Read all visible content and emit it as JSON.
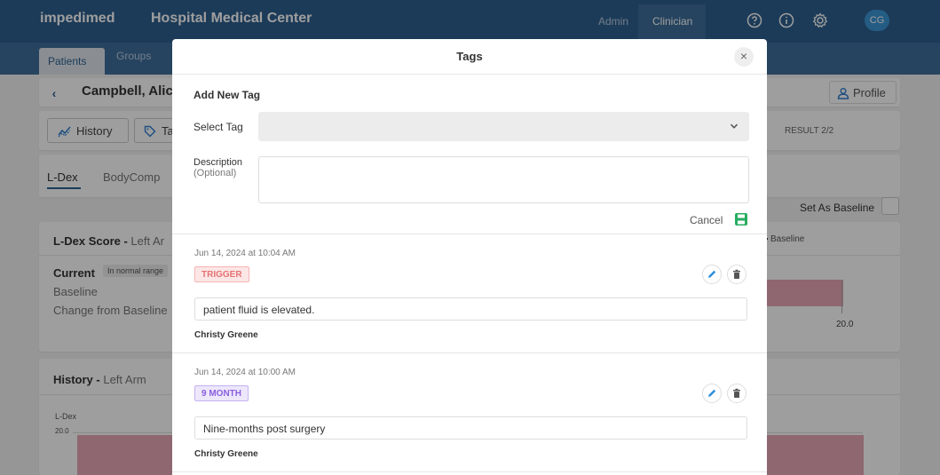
{
  "header": {
    "brand": "impedimed",
    "center_name": "Hospital Medical Center",
    "nav": {
      "admin": "Admin",
      "clinician": "Clinician"
    },
    "icons": [
      "help-circle-icon",
      "info-icon",
      "gear-icon"
    ],
    "avatar": "CG"
  },
  "subnav": {
    "patients": "Patients",
    "groups": "Groups"
  },
  "patient": {
    "back": "‹",
    "name": "Campbell, Alic",
    "profile": "Profile"
  },
  "actions": {
    "history": "History",
    "tags": "Ta",
    "result": "RESULT 2/2"
  },
  "tabs": {
    "ldex": "L-Dex",
    "bodycomp": "BodyComp"
  },
  "baseline": {
    "set_label": "Set As Baseline"
  },
  "score_card": {
    "title": "L-Dex Score - ",
    "subtitle": "Left Ar",
    "current": "Current",
    "range": "In normal range",
    "baseline": "Baseline",
    "change": "Change from Baseline",
    "legend": "Baseline",
    "tick": "20.0"
  },
  "history_card": {
    "title": "History - ",
    "subtitle": "Left Arm",
    "y_label": "L-Dex",
    "y_tick": "20.0"
  },
  "modal": {
    "title": "Tags",
    "close": "×",
    "add_title": "Add New Tag",
    "select_label": "Select Tag",
    "select_value": "",
    "description_label": "Description",
    "description_optional": "(Optional)",
    "description_value": "",
    "cancel": "Cancel",
    "entries": [
      {
        "date": "Jun 14, 2024 at 10:04 AM",
        "tag": "TRIGGER",
        "text": "patient fluid is elevated.",
        "author": "Christy Greene"
      },
      {
        "date": "Jun 14, 2024 at 10:00 AM",
        "tag": "9 MONTH",
        "text": "Nine-months post surgery",
        "author": "Christy Greene"
      }
    ]
  },
  "colors": {
    "topbar": "#2e5f8f",
    "subnav": "#3e6e9c",
    "trigger_badge": "#e57373",
    "month_badge": "#8a5fe0",
    "chart_bar": "#e5a7b7",
    "save_icon": "#27ae60",
    "edit_icon": "#2f8fd8"
  }
}
